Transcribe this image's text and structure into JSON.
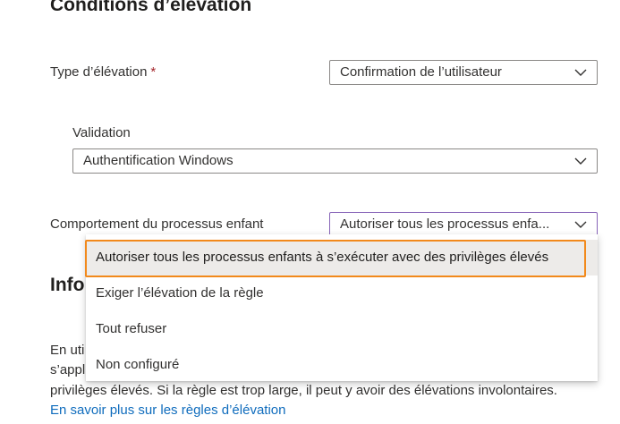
{
  "section": {
    "title": "Conditions d’élévation"
  },
  "elevation_type": {
    "label": "Type d’élévation",
    "required_marker": "*",
    "value": "Confirmation de l’utilisateur"
  },
  "validation": {
    "label": "Validation",
    "value": "Authentification Windows"
  },
  "child_process": {
    "label": "Comportement du processus enfant",
    "value": "Autoriser tous les processus enfa...",
    "options": [
      "Autoriser tous les processus enfants à s’exécuter avec des privilèges élevés",
      "Exiger l’élévation de la règle",
      "Tout refuser",
      "Non configuré"
    ]
  },
  "info": {
    "title_partial": "Info",
    "line1_partial": "En uti",
    "line2_partial": "s’appl",
    "line3": "privilèges élevés. Si la règle est trop large, il peut y avoir des élévations involontaires.",
    "link": "En savoir plus sur les règles d’élévation"
  },
  "colors": {
    "focus_ring": "#f2891b",
    "active_border": "#8764b8",
    "link": "#0f6cbd"
  },
  "icons": [
    "chevron-down-icon"
  ]
}
